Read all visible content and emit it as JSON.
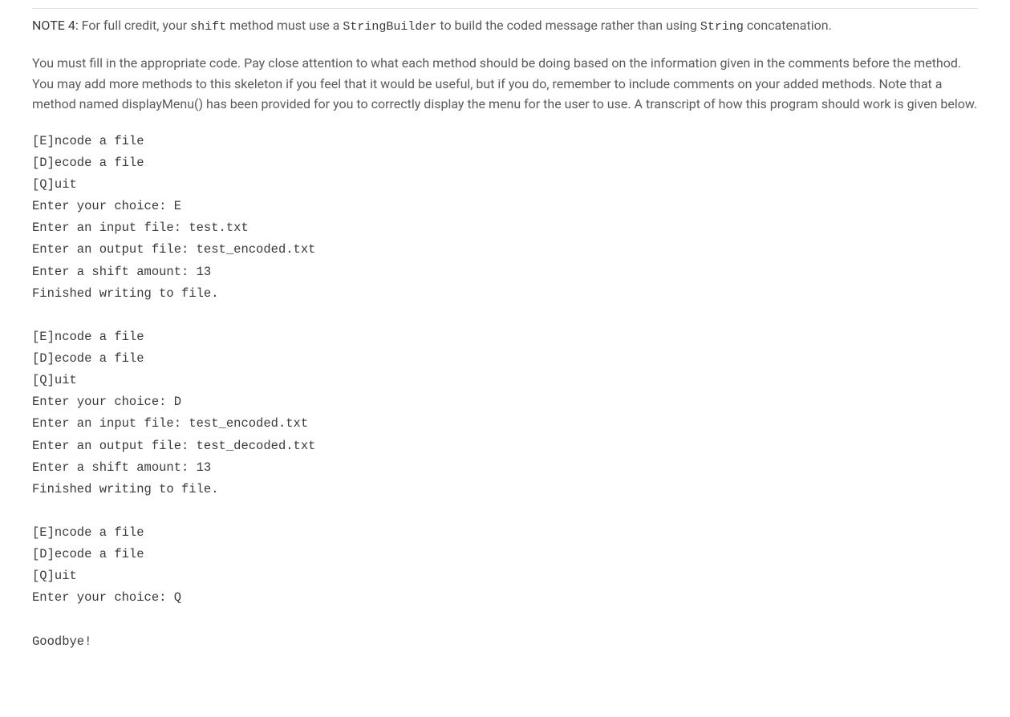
{
  "note": {
    "prefix": "NOTE 4:",
    "text_before_shift": " For full credit, your ",
    "code_shift": "shift",
    "text_mid1": " method must use a ",
    "code_sb": "StringBuilder",
    "text_mid2": " to build the coded message rather than using ",
    "code_string": "String",
    "text_after": " concatenation."
  },
  "instructions": "You must fill in the appropriate code. Pay close attention to what each method should be doing based on the information given in the comments before the method. You may add more methods to this skeleton if you feel that it would be useful, but if you do, remember to include comments on your added methods. Note that a method named displayMenu() has been provided for you to correctly display the menu for the user to use. A transcript of how this program should work is given below.",
  "transcript": "[E]ncode a file\n[D]ecode a file\n[Q]uit\nEnter your choice: E\nEnter an input file: test.txt\nEnter an output file: test_encoded.txt\nEnter a shift amount: 13\nFinished writing to file.\n\n[E]ncode a file\n[D]ecode a file\n[Q]uit\nEnter your choice: D\nEnter an input file: test_encoded.txt\nEnter an output file: test_decoded.txt\nEnter a shift amount: 13\nFinished writing to file.\n\n[E]ncode a file\n[D]ecode a file\n[Q]uit\nEnter your choice: Q\n\nGoodbye!"
}
